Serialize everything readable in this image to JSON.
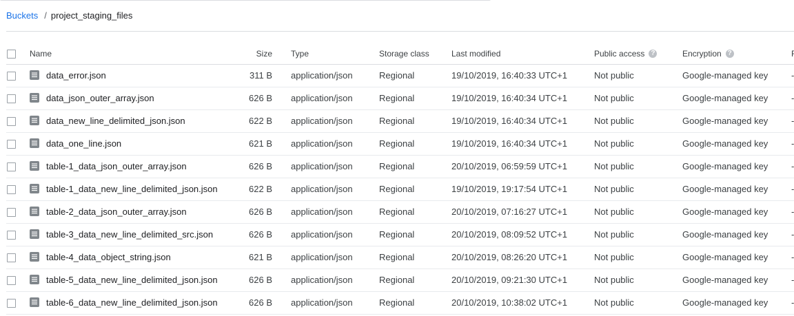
{
  "breadcrumb": {
    "root_label": "Buckets",
    "separator": "/",
    "current": "project_staging_files"
  },
  "table": {
    "headers": {
      "name": "Name",
      "size": "Size",
      "type": "Type",
      "storage_class": "Storage class",
      "last_modified": "Last modified",
      "public_access": "Public access",
      "encryption": "Encryption",
      "extra": "F"
    },
    "rows": [
      {
        "name": "data_error.json",
        "size": "311 B",
        "type": "application/json",
        "storage_class": "Regional",
        "last_modified": "19/10/2019, 16:40:33 UTC+1",
        "public_access": "Not public",
        "encryption": "Google-managed key",
        "extra": "-"
      },
      {
        "name": "data_json_outer_array.json",
        "size": "626 B",
        "type": "application/json",
        "storage_class": "Regional",
        "last_modified": "19/10/2019, 16:40:34 UTC+1",
        "public_access": "Not public",
        "encryption": "Google-managed key",
        "extra": "-"
      },
      {
        "name": "data_new_line_delimited_json.json",
        "size": "622 B",
        "type": "application/json",
        "storage_class": "Regional",
        "last_modified": "19/10/2019, 16:40:34 UTC+1",
        "public_access": "Not public",
        "encryption": "Google-managed key",
        "extra": "-"
      },
      {
        "name": "data_one_line.json",
        "size": "621 B",
        "type": "application/json",
        "storage_class": "Regional",
        "last_modified": "19/10/2019, 16:40:34 UTC+1",
        "public_access": "Not public",
        "encryption": "Google-managed key",
        "extra": "-"
      },
      {
        "name": "table-1_data_json_outer_array.json",
        "size": "626 B",
        "type": "application/json",
        "storage_class": "Regional",
        "last_modified": "20/10/2019, 06:59:59 UTC+1",
        "public_access": "Not public",
        "encryption": "Google-managed key",
        "extra": "-"
      },
      {
        "name": "table-1_data_new_line_delimited_json.json",
        "size": "622 B",
        "type": "application/json",
        "storage_class": "Regional",
        "last_modified": "19/10/2019, 19:17:54 UTC+1",
        "public_access": "Not public",
        "encryption": "Google-managed key",
        "extra": "-"
      },
      {
        "name": "table-2_data_json_outer_array.json",
        "size": "626 B",
        "type": "application/json",
        "storage_class": "Regional",
        "last_modified": "20/10/2019, 07:16:27 UTC+1",
        "public_access": "Not public",
        "encryption": "Google-managed key",
        "extra": "-"
      },
      {
        "name": "table-3_data_new_line_delimited_src.json",
        "size": "626 B",
        "type": "application/json",
        "storage_class": "Regional",
        "last_modified": "20/10/2019, 08:09:52 UTC+1",
        "public_access": "Not public",
        "encryption": "Google-managed key",
        "extra": "-"
      },
      {
        "name": "table-4_data_object_string.json",
        "size": "621 B",
        "type": "application/json",
        "storage_class": "Regional",
        "last_modified": "20/10/2019, 08:26:20 UTC+1",
        "public_access": "Not public",
        "encryption": "Google-managed key",
        "extra": "-"
      },
      {
        "name": "table-5_data_new_line_delimited_json.json",
        "size": "626 B",
        "type": "application/json",
        "storage_class": "Regional",
        "last_modified": "20/10/2019, 09:21:30 UTC+1",
        "public_access": "Not public",
        "encryption": "Google-managed key",
        "extra": "-"
      },
      {
        "name": "table-6_data_new_line_delimited_json.json",
        "size": "626 B",
        "type": "application/json",
        "storage_class": "Regional",
        "last_modified": "20/10/2019, 10:38:02 UTC+1",
        "public_access": "Not public",
        "encryption": "Google-managed key",
        "extra": "-"
      }
    ]
  },
  "icons": {
    "file": "file-document-icon",
    "help": "help-circle-icon",
    "help_glyph": "?"
  },
  "colors": {
    "link": "#1a73e8",
    "divider": "#dadce0",
    "icon": "#80868b"
  }
}
